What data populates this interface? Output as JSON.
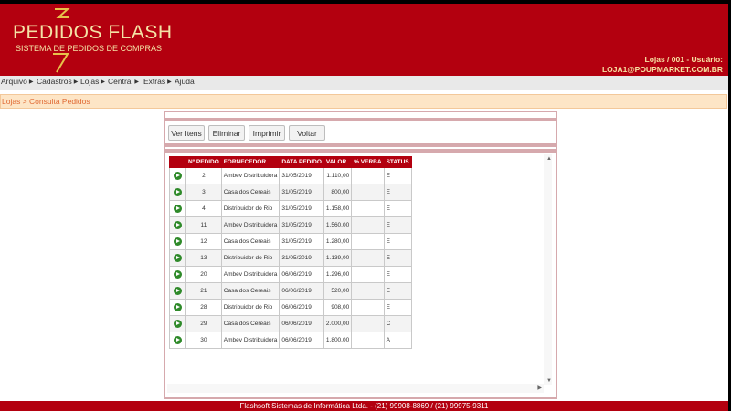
{
  "header": {
    "logo_title": "PEDIDOS FLASH",
    "logo_subtitle": "SISTEMA DE PEDIDOS DE COMPRAS",
    "user_line1": "Lojas / 001 - Usuário:",
    "user_line2": "LOJA1@POUPMARKET.COM.BR"
  },
  "menu": [
    {
      "label": "Arquivo"
    },
    {
      "label": "Cadastros"
    },
    {
      "label": "Lojas"
    },
    {
      "label": "Central"
    },
    {
      "label": "Extras"
    },
    {
      "label": "Ajuda"
    }
  ],
  "breadcrumb": "Lojas > Consulta Pedidos",
  "toolbar": {
    "ver_itens": "Ver Itens",
    "eliminar": "Eliminar",
    "imprimir": "Imprimir",
    "voltar": "Voltar"
  },
  "table": {
    "headers": [
      "Nº PEDIDO",
      "FORNECEDOR",
      "DATA PEDIDO",
      "VALOR",
      "% VERBA",
      "STATUS"
    ],
    "rows": [
      {
        "pedido": "2",
        "fornecedor": "Ambev Distribuidora",
        "data": "31/05/2019",
        "valor": "1.110,00",
        "verba": "",
        "status": "E"
      },
      {
        "pedido": "3",
        "fornecedor": "Casa dos Cereais",
        "data": "31/05/2019",
        "valor": "800,00",
        "verba": "",
        "status": "E"
      },
      {
        "pedido": "4",
        "fornecedor": "Distribuidor do Rio",
        "data": "31/05/2019",
        "valor": "1.158,00",
        "verba": "",
        "status": "E"
      },
      {
        "pedido": "11",
        "fornecedor": "Ambev Distribuidora",
        "data": "31/05/2019",
        "valor": "1.560,00",
        "verba": "",
        "status": "E"
      },
      {
        "pedido": "12",
        "fornecedor": "Casa dos Cereais",
        "data": "31/05/2019",
        "valor": "1.280,00",
        "verba": "",
        "status": "E"
      },
      {
        "pedido": "13",
        "fornecedor": "Distribuidor do Rio",
        "data": "31/05/2019",
        "valor": "1.139,00",
        "verba": "",
        "status": "E"
      },
      {
        "pedido": "20",
        "fornecedor": "Ambev Distribuidora",
        "data": "06/06/2019",
        "valor": "1.296,00",
        "verba": "",
        "status": "E"
      },
      {
        "pedido": "21",
        "fornecedor": "Casa dos Cereais",
        "data": "06/06/2019",
        "valor": "520,00",
        "verba": "",
        "status": "E"
      },
      {
        "pedido": "28",
        "fornecedor": "Distribuidor do Rio",
        "data": "06/06/2019",
        "valor": "908,00",
        "verba": "",
        "status": "E"
      },
      {
        "pedido": "29",
        "fornecedor": "Casa dos Cereais",
        "data": "06/06/2019",
        "valor": "2.000,00",
        "verba": "",
        "status": "C"
      },
      {
        "pedido": "30",
        "fornecedor": "Ambev Distribuidora",
        "data": "06/06/2019",
        "valor": "1.800,00",
        "verba": "",
        "status": "A"
      }
    ]
  },
  "footer": "Flashsoft Sistemas de Informática Ltda. - (21) 99908-8869 / (21) 99975-9311",
  "colors": {
    "brand_red": "#b3000f",
    "logo_gold": "#f4e3a6",
    "breadcrumb_text": "#e06a34",
    "action_icon": "#2f8a2a"
  },
  "icons": {
    "row_action": "arrow-right-circle-icon",
    "menu_arrow": "caret-right-icon"
  }
}
